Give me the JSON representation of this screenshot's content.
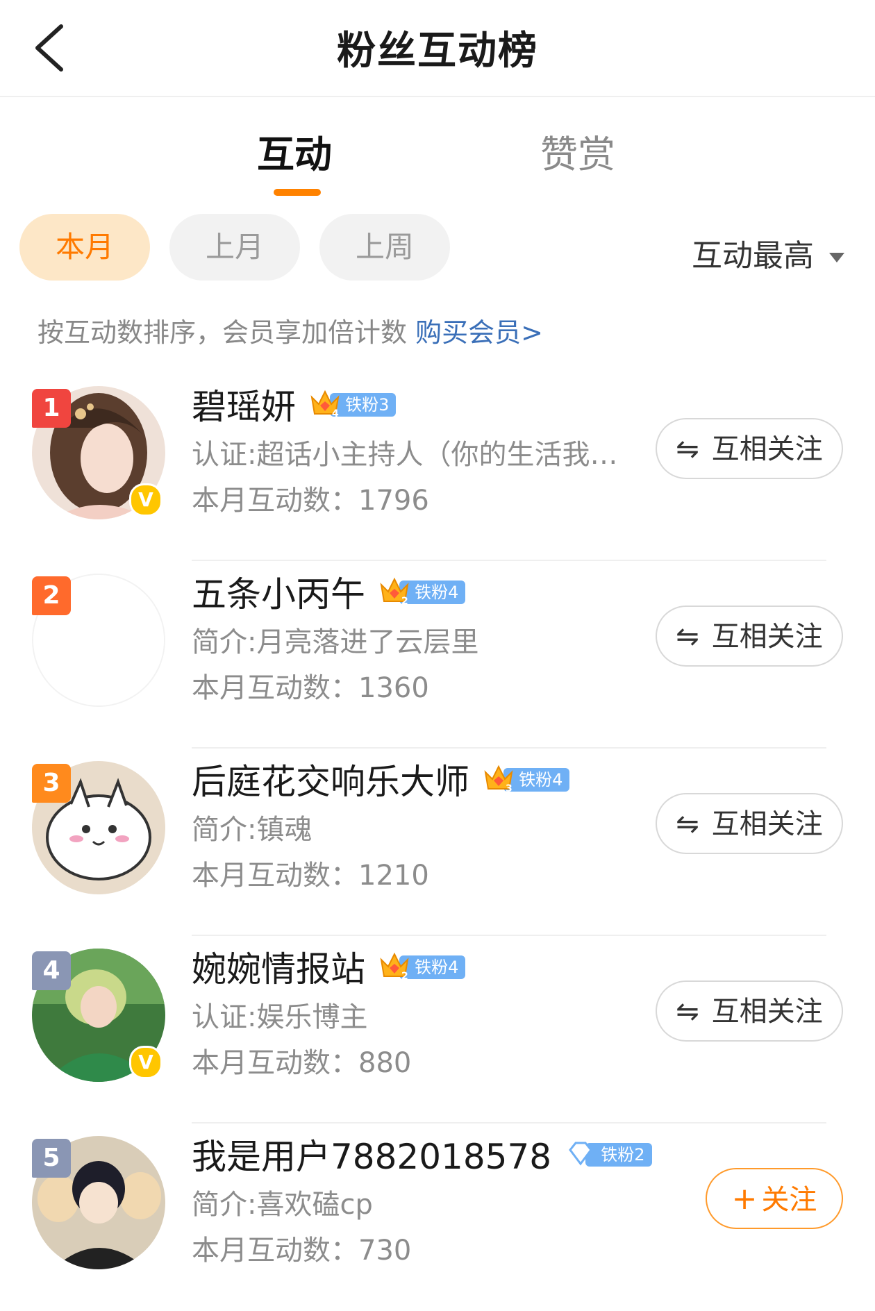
{
  "header": {
    "title": "粉丝互动榜",
    "back_icon": "chevron-left-icon"
  },
  "tabs": [
    {
      "label": "互动",
      "active": true
    },
    {
      "label": "赞赏",
      "active": false
    }
  ],
  "filters": {
    "chips": [
      "本月",
      "上月",
      "上周"
    ],
    "active": "本月",
    "sort_label": "互动最高"
  },
  "hint": {
    "text": "按互动数排序，会员享加倍计数 ",
    "link": "购买会员>"
  },
  "colors": {
    "accent": "#ff8200",
    "rank1": "#f0453f",
    "rank2": "#ff6a2c",
    "rank3": "#ff8a1d",
    "rank_other": "#8a96b4",
    "badge_blue": "#6fb0f5"
  },
  "fans": [
    {
      "rank": "1",
      "name": "碧瑶妍",
      "crown_level": "4",
      "fan_badge": "铁粉3",
      "desc": "认证:超话小主持人（你的生活我…",
      "count_label": "本月互动数：",
      "count": "1796",
      "verified": true,
      "button": "互相关注"
    },
    {
      "rank": "2",
      "name": "五条小丙午",
      "crown_level": "2",
      "fan_badge": "铁粉4",
      "desc": "简介:月亮落进了云层里",
      "count_label": "本月互动数：",
      "count": "1360",
      "verified": false,
      "button": "互相关注"
    },
    {
      "rank": "3",
      "name": "后庭花交响乐大师",
      "crown_level": "3",
      "fan_badge": "铁粉4",
      "desc": "简介:镇魂",
      "count_label": "本月互动数：",
      "count": "1210",
      "verified": false,
      "button": "互相关注"
    },
    {
      "rank": "4",
      "name": "婉婉情报站",
      "crown_level": "2",
      "fan_badge": "铁粉4",
      "desc": "认证:娱乐博主",
      "count_label": "本月互动数：",
      "count": "880",
      "verified": true,
      "button": "互相关注"
    },
    {
      "rank": "5",
      "name": "我是用户7882018578",
      "crown_level": "",
      "fan_badge": "铁粉2",
      "desc": "简介:喜欢磕cp",
      "count_label": "本月互动数：",
      "count": "730",
      "verified": false,
      "button": "关注"
    }
  ]
}
